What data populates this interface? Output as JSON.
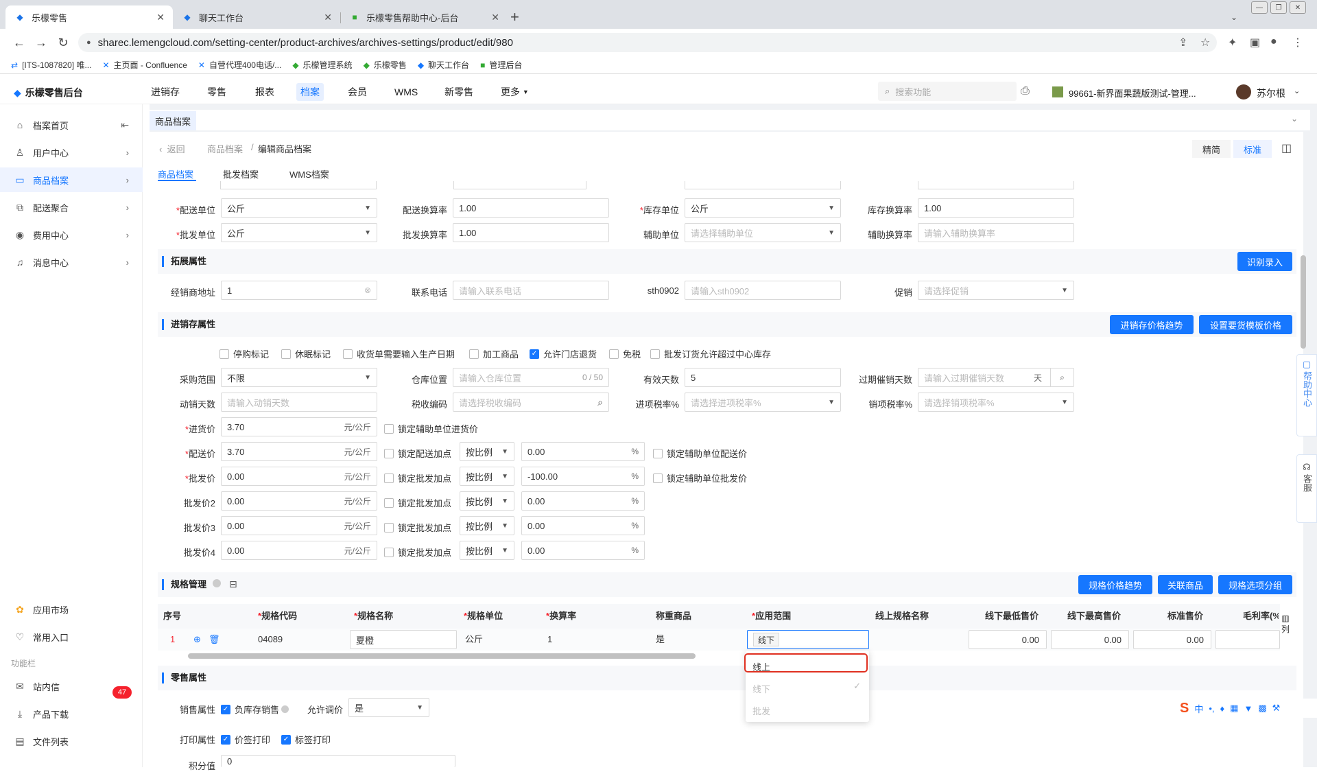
{
  "browser": {
    "tabs": [
      {
        "title": "乐檬零售"
      },
      {
        "title": "聊天工作台"
      },
      {
        "title": "乐檬零售帮助中心-后台"
      }
    ],
    "url": "sharec.lemengcloud.com/setting-center/product-archives/archives-settings/product/edit/980",
    "bookmarks": [
      "[ITS-1087820] 唯...",
      "主页面 - Confluence",
      "自营代理400电话/...",
      "乐檬管理系统",
      "乐檬零售",
      "聊天工作台",
      "管理后台"
    ]
  },
  "app": {
    "brand": "乐檬零售后台",
    "nav": [
      "进销存",
      "零售",
      "报表",
      "档案",
      "会员",
      "WMS",
      "新零售",
      "更多"
    ],
    "search_placeholder": "搜索功能",
    "store": "99661-新界面果蔬版测试-管理...",
    "user": "苏尔根"
  },
  "sidebar": {
    "items": [
      "档案首页",
      "用户中心",
      "商品档案",
      "配送聚合",
      "费用中心",
      "消息中心"
    ],
    "bottom": [
      "应用市场",
      "常用入口"
    ],
    "section": "功能栏",
    "tools": [
      "站内信",
      "产品下载",
      "文件列表"
    ],
    "badge": "47"
  },
  "page": {
    "tab": "商品档案",
    "back": "返回",
    "crumb1": "商品档案",
    "crumb2": "编辑商品档案",
    "view_simple": "精简",
    "view_standard": "标准",
    "form_tabs": [
      "商品档案",
      "批发档案",
      "WMS档案"
    ]
  },
  "units": {
    "delivery_unit_label": "配送单位",
    "delivery_unit": "公斤",
    "delivery_rate_label": "配送换算率",
    "delivery_rate": "1.00",
    "stock_unit_label": "库存单位",
    "stock_unit": "公斤",
    "stock_rate_label": "库存换算率",
    "stock_rate": "1.00",
    "wholesale_unit_label": "批发单位",
    "wholesale_unit": "公斤",
    "wholesale_rate_label": "批发换算率",
    "wholesale_rate": "1.00",
    "aux_unit_label": "辅助单位",
    "aux_unit_ph": "请选择辅助单位",
    "aux_rate_label": "辅助换算率",
    "aux_rate_ph": "请输入辅助换算率"
  },
  "ext": {
    "title": "拓展属性",
    "btn": "识别录入",
    "dealer_label": "经销商地址",
    "dealer": "1",
    "phone_label": "联系电话",
    "phone_ph": "请输入联系电话",
    "sth_label": "sth0902",
    "sth_ph": "请输入sth0902",
    "promo_label": "促销",
    "promo_ph": "请选择促销"
  },
  "inv": {
    "title": "进销存属性",
    "btn1": "进销存价格趋势",
    "btn2": "设置要货模板价格",
    "checks": [
      "停购标记",
      "休眠标记",
      "收货单需要输入生产日期",
      "加工商品",
      "允许门店退货",
      "免税",
      "批发订货允许超过中心库存"
    ],
    "purchase_scope_label": "采购范围",
    "purchase_scope": "不限",
    "location_label": "仓库位置",
    "location_ph": "请输入仓库位置",
    "location_count": "0 / 50",
    "valid_days_label": "有效天数",
    "valid_days": "5",
    "expire_label": "过期催销天数",
    "expire_ph": "请输入过期催销天数",
    "expire_unit": "天",
    "move_days_label": "动销天数",
    "move_days_ph": "请输入动销天数",
    "tax_code_label": "税收编码",
    "tax_code_ph": "请选择税收编码",
    "in_tax_label": "进项税率%",
    "in_tax_ph": "请选择进项税率%",
    "out_tax_label": "销项税率%",
    "out_tax_ph": "请选择销项税率%",
    "unit_suffix": "元/公斤",
    "mode": "按比例",
    "prices": [
      {
        "label": "进货价",
        "value": "3.70",
        "lock": "锁定辅助单位进货价"
      },
      {
        "label": "配送价",
        "value": "3.70",
        "lock": "锁定配送加点",
        "pct": "0.00",
        "lock2": "锁定辅助单位配送价"
      },
      {
        "label": "批发价",
        "value": "0.00",
        "lock": "锁定批发加点",
        "pct": "-100.00",
        "lock2": "锁定辅助单位批发价"
      },
      {
        "label": "批发价2",
        "value": "0.00",
        "lock": "锁定批发加点",
        "pct": "0.00"
      },
      {
        "label": "批发价3",
        "value": "0.00",
        "lock": "锁定批发加点",
        "pct": "0.00"
      },
      {
        "label": "批发价4",
        "value": "0.00",
        "lock": "锁定批发加点",
        "pct": "0.00"
      }
    ]
  },
  "spec": {
    "title": "规格管理",
    "btn1": "规格价格趋势",
    "btn2": "关联商品",
    "btn3": "规格选项分组",
    "headers": [
      "序号",
      "规格代码",
      "规格名称",
      "规格单位",
      "换算率",
      "称重商品",
      "应用范围",
      "线上规格名称",
      "线下最低售价",
      "线下最高售价",
      "标准售价",
      "毛利率(%"
    ],
    "row": {
      "idx": "1",
      "code": "04089",
      "name": "夏橙",
      "unit": "公斤",
      "rate": "1",
      "weighed": "是",
      "scope_tag": "线下",
      "min": "0.00",
      "max": "0.00",
      "std": "0.00"
    },
    "col_btn": "列",
    "dropdown": [
      "线上",
      "线下",
      "批发"
    ]
  },
  "retail": {
    "title": "零售属性",
    "sale_label": "销售属性",
    "sale_check": "负库存销售",
    "adjust_label": "允许调价",
    "adjust": "是",
    "print_label": "打印属性",
    "print1": "价签打印",
    "print2": "标签打印",
    "points_label": "积分值",
    "points": "0"
  },
  "float": {
    "help": "帮助中心",
    "service": "客服"
  }
}
